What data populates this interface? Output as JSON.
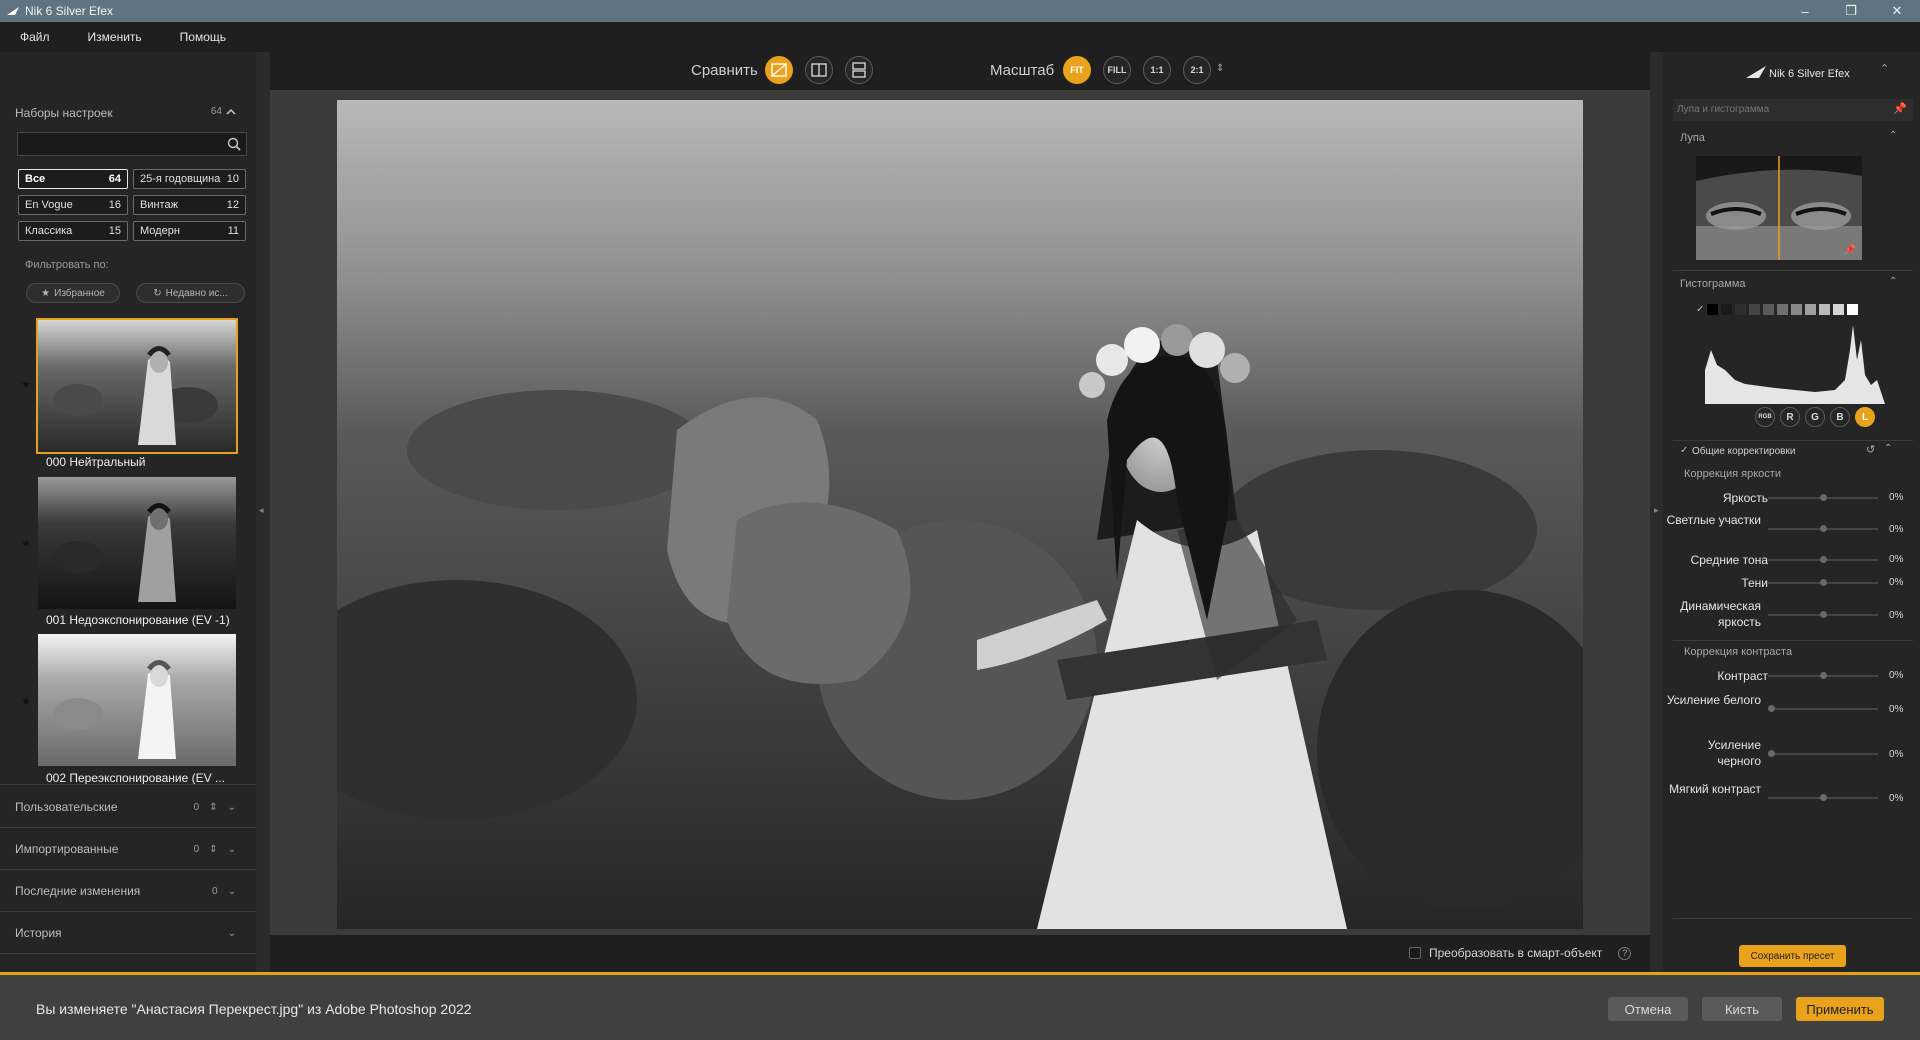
{
  "window": {
    "title": "Nik 6 Silver Efex",
    "minimize": "–",
    "maximize": "❐",
    "close": "✕"
  },
  "menu": [
    "Файл",
    "Изменить",
    "Помощь"
  ],
  "left": {
    "presets_title": "Наборы настроек",
    "presets_count": "64",
    "search": {
      "placeholder": "",
      "value": ""
    },
    "tags": [
      {
        "label": "Все",
        "count": "64"
      },
      {
        "label": "25-я годовщина",
        "count": "10"
      },
      {
        "label": "En Vogue",
        "count": "16"
      },
      {
        "label": "Винтаж",
        "count": "12"
      },
      {
        "label": "Классика",
        "count": "15"
      },
      {
        "label": "Модерн",
        "count": "11"
      }
    ],
    "filter_label": "Фильтровать по:",
    "filters": [
      "Избранное",
      "Недавно ис..."
    ],
    "presets": [
      {
        "label": "000 Нейтральный"
      },
      {
        "label": "001 Недоэкспонирование (EV -1)"
      },
      {
        "label": "002 Переэкспонирование (EV ..."
      }
    ],
    "sections": [
      {
        "label": "Пользовательские",
        "count": "0"
      },
      {
        "label": "Импортированные",
        "count": "0"
      },
      {
        "label": "Последние изменения",
        "count": "0"
      },
      {
        "label": "История",
        "count": ""
      }
    ]
  },
  "toolbar": {
    "compare_label": "Сравнить",
    "zoom_label": "Масштаб",
    "zoom_options": [
      "FIT",
      "FILL",
      "1:1",
      "2:1"
    ]
  },
  "canvas": {
    "smart_object_label": "Преобразовать в смарт-объект",
    "help": "?"
  },
  "right": {
    "product": "Nik 6 Silver Efex",
    "loupe_hist_title": "Лупа и гистограмма",
    "loupe_title": "Лупа",
    "histogram_title": "Гистограмма",
    "channels": [
      "RGB",
      "R",
      "G",
      "B",
      "L"
    ],
    "global_adjust_label": "Общие корректировки",
    "brightness_title": "Коррекция яркости",
    "brightness": [
      {
        "label": "Яркость",
        "value": "0%",
        "level": 0.5
      },
      {
        "label": "Светлые участки",
        "value": "0%",
        "level": 0.5
      },
      {
        "label": "Средние тона",
        "value": "0%",
        "level": 0.5
      },
      {
        "label": "Тени",
        "value": "0%",
        "level": 0.5
      },
      {
        "label": "Динамическая яркость",
        "value": "0%",
        "level": 0.5
      }
    ],
    "contrast_title": "Коррекция контраста",
    "contrast": [
      {
        "label": "Контраст",
        "value": "0%",
        "level": 0.5
      },
      {
        "label": "Усиление белого",
        "value": "0%",
        "level": 0.0
      },
      {
        "label": "Усиление черного",
        "value": "0%",
        "level": 0.0
      },
      {
        "label": "Мягкий контраст",
        "value": "0%",
        "level": 0.5
      }
    ],
    "save_preset": "Сохранить пресет"
  },
  "status": {
    "text": "Вы изменяете \"Анастасия Перекрест.jpg\" из Adobe Photoshop 2022",
    "cancel": "Отмена",
    "brush": "Кисть",
    "apply": "Применить"
  },
  "colors": {
    "accent": "#e8a21c",
    "titlebar": "#5f7480",
    "panel": "#252525",
    "canvas": "#3b3b3b"
  }
}
